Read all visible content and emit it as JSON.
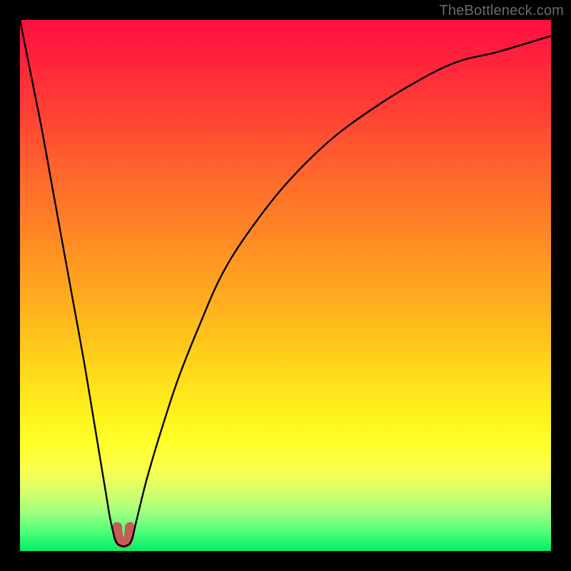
{
  "watermark": "TheBottleneck.com",
  "chart_data": {
    "type": "line",
    "title": "",
    "xlabel": "",
    "ylabel": "",
    "xlim": [
      0,
      100
    ],
    "ylim": [
      0,
      100
    ],
    "grid": false,
    "legend": false,
    "gradient_stops": [
      {
        "pos": 0,
        "color": "#ff0d3e"
      },
      {
        "pos": 18,
        "color": "#ff4234"
      },
      {
        "pos": 42,
        "color": "#ff8c24"
      },
      {
        "pos": 66,
        "color": "#ffd81a"
      },
      {
        "pos": 80,
        "color": "#ffff2a"
      },
      {
        "pos": 90,
        "color": "#c8ff72"
      },
      {
        "pos": 100,
        "color": "#00ef66"
      }
    ],
    "series": [
      {
        "name": "bottleneck-curve",
        "color": "#000000",
        "x": [
          0,
          2,
          4,
          6,
          8,
          10,
          12,
          14,
          16,
          17,
          18,
          19,
          20,
          21,
          22,
          24,
          27,
          30,
          34,
          38,
          43,
          50,
          58,
          66,
          74,
          82,
          90,
          100
        ],
        "y": [
          100,
          90,
          80,
          69,
          58,
          47,
          36,
          24,
          12,
          6,
          2,
          1,
          1,
          2,
          6,
          14,
          24,
          33,
          43,
          52,
          60,
          69,
          77,
          83,
          88,
          92,
          94,
          97
        ]
      }
    ],
    "valley_marker": {
      "x_range": [
        18.3,
        20.7
      ],
      "y": 1.5,
      "color": "#c65c58"
    }
  }
}
